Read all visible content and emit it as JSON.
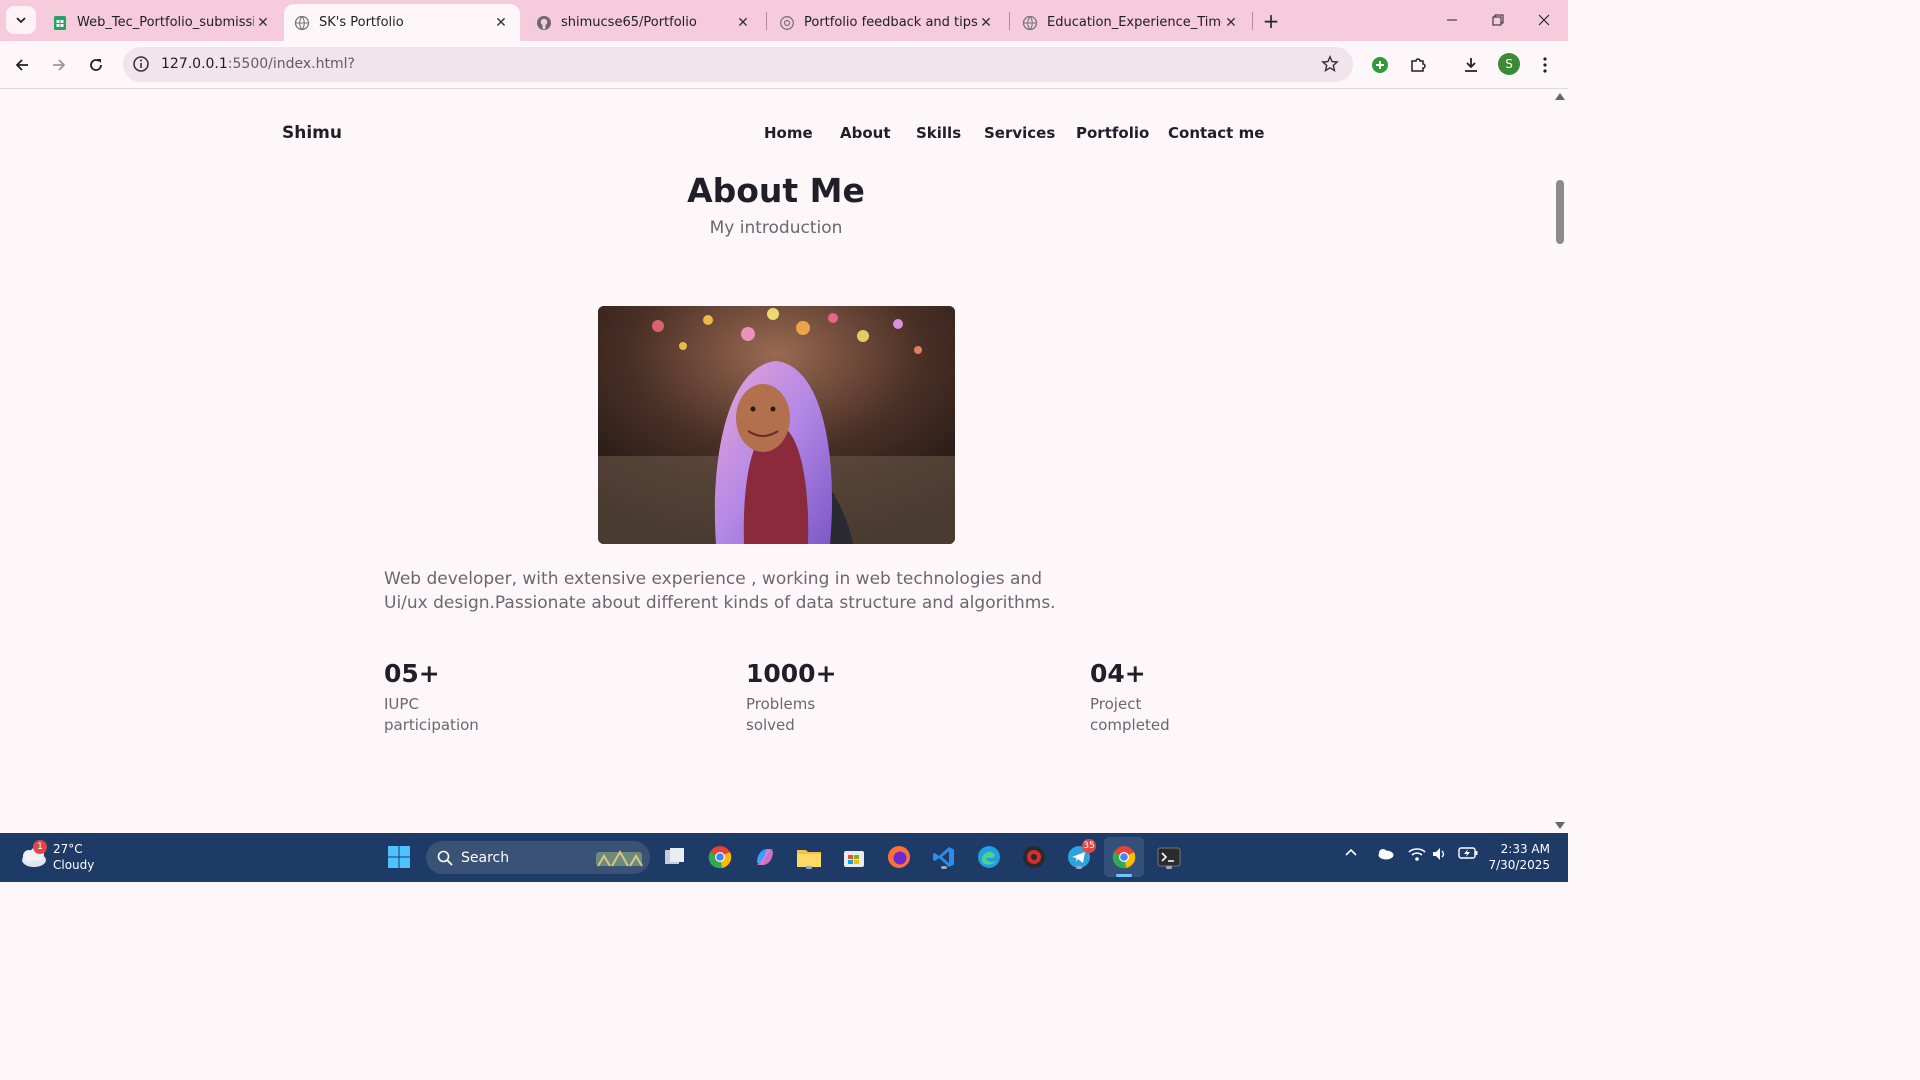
{
  "browser": {
    "tabs": [
      {
        "title": "Web_Tec_Portfolio_submission",
        "icon": "google-sheets-icon",
        "active": false
      },
      {
        "title": "SK's Portfolio",
        "icon": "globe-icon",
        "active": true
      },
      {
        "title": "shimucse65/Portfolio",
        "icon": "github-icon",
        "active": false
      },
      {
        "title": "Portfolio feedback and tips",
        "icon": "globe-icon",
        "active": false
      },
      {
        "title": "Education_Experience_Timeline",
        "icon": "globe-icon",
        "active": false
      }
    ],
    "url_host": "127.0.0.1",
    "url_rest": ":5500/index.html?",
    "profile_initial": "S"
  },
  "page": {
    "logo": "Shimu",
    "nav": [
      "Home",
      "About",
      "Skills",
      "Services",
      "Portfolio",
      "Contact me"
    ],
    "section_title": "About Me",
    "section_subtitle": "My introduction",
    "description": "Web developer, with extensive experience , working in web technologies and Ui/ux design.Passionate about different kinds of data structure and algorithms.",
    "stats": [
      {
        "value": "05+",
        "label": "IUPC participation"
      },
      {
        "value": "1000+",
        "label": "Problems solved"
      },
      {
        "value": "04+",
        "label": "Project completed"
      }
    ]
  },
  "taskbar": {
    "weather_temp": "27°C",
    "weather_desc": "Cloudy",
    "weather_badge": "1",
    "search_label": "Search",
    "telegram_badge": "35",
    "time": "2:33 AM",
    "date": "7/30/2025"
  },
  "colors": {
    "tabstrip": "#f6cbdc",
    "page_bg": "#fdf7f9",
    "heading": "#1f1f2a",
    "text_muted": "#6a6770",
    "taskbar": "#1e3a66"
  }
}
